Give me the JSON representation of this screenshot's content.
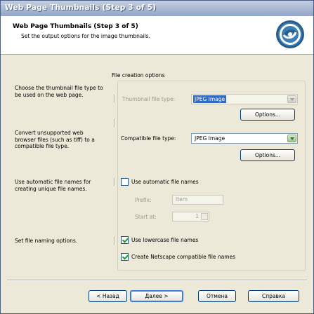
{
  "window": {
    "title": "Web Page Thumbnails (Step 3 of 5)"
  },
  "header": {
    "title": "Web Page Thumbnails (Step 3 of 5)",
    "subtitle": "Set the output options for the image thumbnails.",
    "logo_icon": "swirl-logo-icon"
  },
  "descriptions": {
    "thumbnail": "Choose the thumbnail file type to be used on the web page.",
    "compatible": "Convert unsupported web browser files (such as tiff) to a compatible file type.",
    "automatic": "Use automatic file names for creating unique file names.",
    "naming": "Set file naming options."
  },
  "group": {
    "label": "File creation options",
    "thumbnail_type_label": "Thumbnail file type:",
    "thumbnail_type_value": "JPEG Image",
    "thumbnail_options_button": "Options...",
    "compatible_type_label": "Compatible file type:",
    "compatible_type_value": "JPEG Image",
    "compatible_options_button": "Options...",
    "auto_names_label": "Use automatic file names",
    "auto_names_checked": false,
    "prefix_label": "Prefix:",
    "prefix_value": "Item",
    "start_at_label": "Start at:",
    "start_at_value": "1",
    "lowercase_label": "Use lowercase file names",
    "lowercase_checked": true,
    "netscape_label": "Create Netscape compatible file names",
    "netscape_checked": true
  },
  "footer": {
    "back_button": "< Назад",
    "next_button": "Далее >",
    "cancel_button": "Отмена",
    "help_button": "Справка"
  },
  "colors": {
    "titlebar": "#93a5c7",
    "selection": "#316ac5",
    "button_border": "#003c74",
    "check_mark": "#21a121"
  }
}
